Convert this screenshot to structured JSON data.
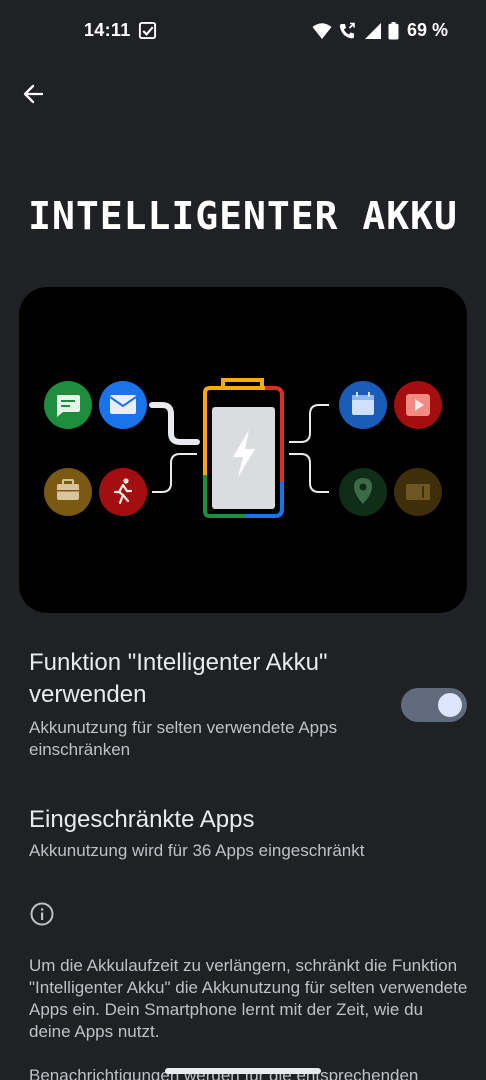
{
  "status_bar": {
    "time": "14:11",
    "battery_text": "69 %",
    "icons": [
      "checkbox-notification-icon",
      "wifi-icon",
      "wifi-calling-icon",
      "cellular-signal-icon",
      "battery-icon"
    ]
  },
  "header": {
    "back_icon": "arrow-left-icon",
    "title": "INTELLIGENTER AKKU"
  },
  "illustration": {
    "left_apps": [
      "messages-app-icon",
      "email-app-icon",
      "briefcase-app-icon",
      "fitness-app-icon"
    ],
    "right_apps": [
      "calendar-app-icon",
      "video-app-icon",
      "maps-app-icon",
      "tv-app-icon"
    ],
    "battery_colors": [
      "#f9ab00",
      "#d93025",
      "#1a73e8",
      "#1e8e3e"
    ]
  },
  "settings": {
    "adaptive_battery": {
      "title": "Funktion \"Intelligenter Akku\" verwenden",
      "summary": "Akkunutzung für selten verwendete Apps einschränken",
      "enabled": true
    },
    "restricted_apps": {
      "title": "Eingeschränkte Apps",
      "summary": "Akkunutzung wird für 36 Apps eingeschränkt"
    }
  },
  "info": {
    "icon": "info-icon",
    "paragraph1": "Um die Akkulaufzeit zu verlängern, schränkt die Funktion \"Intelligenter Akku\" die Akkunutzung für selten verwendete Apps ein. Dein Smartphone lernt mit der Zeit, wie du deine Apps nutzt.",
    "paragraph2": "Benachrichtigungen werden für die entsprechenden"
  },
  "colors": {
    "background": "#202124",
    "toggle_track": "#5f6b7c",
    "toggle_knob": "#dde6ff"
  }
}
